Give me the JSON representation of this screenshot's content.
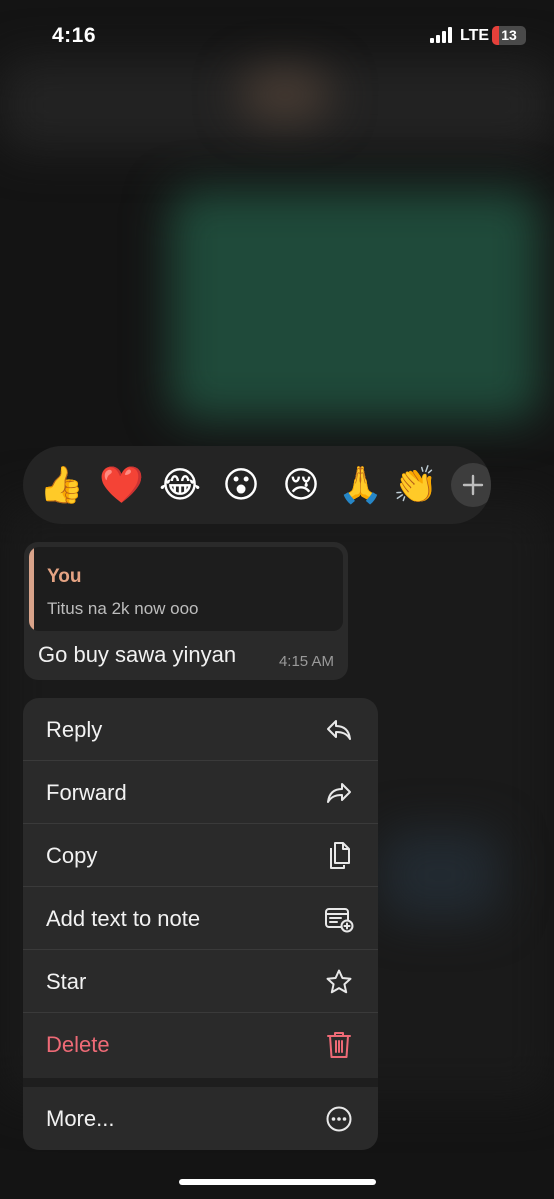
{
  "status_bar": {
    "time": "4:16",
    "network": "LTE",
    "battery_level": "13"
  },
  "reactions": {
    "emojis": [
      {
        "char": "👍",
        "name": "thumbs-up"
      },
      {
        "char": "❤️",
        "name": "red-heart"
      },
      {
        "char": "😂",
        "name": "tears-of-joy"
      },
      {
        "char": "😮",
        "name": "open-mouth"
      },
      {
        "char": "😢",
        "name": "crying-face"
      },
      {
        "char": "🙏",
        "name": "folded-hands"
      },
      {
        "char": "👏",
        "name": "clapping-hands"
      }
    ],
    "more_icon": "plus-icon"
  },
  "message": {
    "quote_author": "You",
    "quote_text": "Titus na 2k now ooo",
    "text": "Go buy sawa yinyan",
    "time": "4:15 AM"
  },
  "menu": {
    "reply": "Reply",
    "forward": "Forward",
    "copy": "Copy",
    "add_to_note": "Add text to note",
    "star": "Star",
    "delete": "Delete",
    "more": "More..."
  },
  "colors": {
    "accent_quote": "#e5a383",
    "danger": "#ee6a76",
    "battery_low": "#e5403a"
  }
}
